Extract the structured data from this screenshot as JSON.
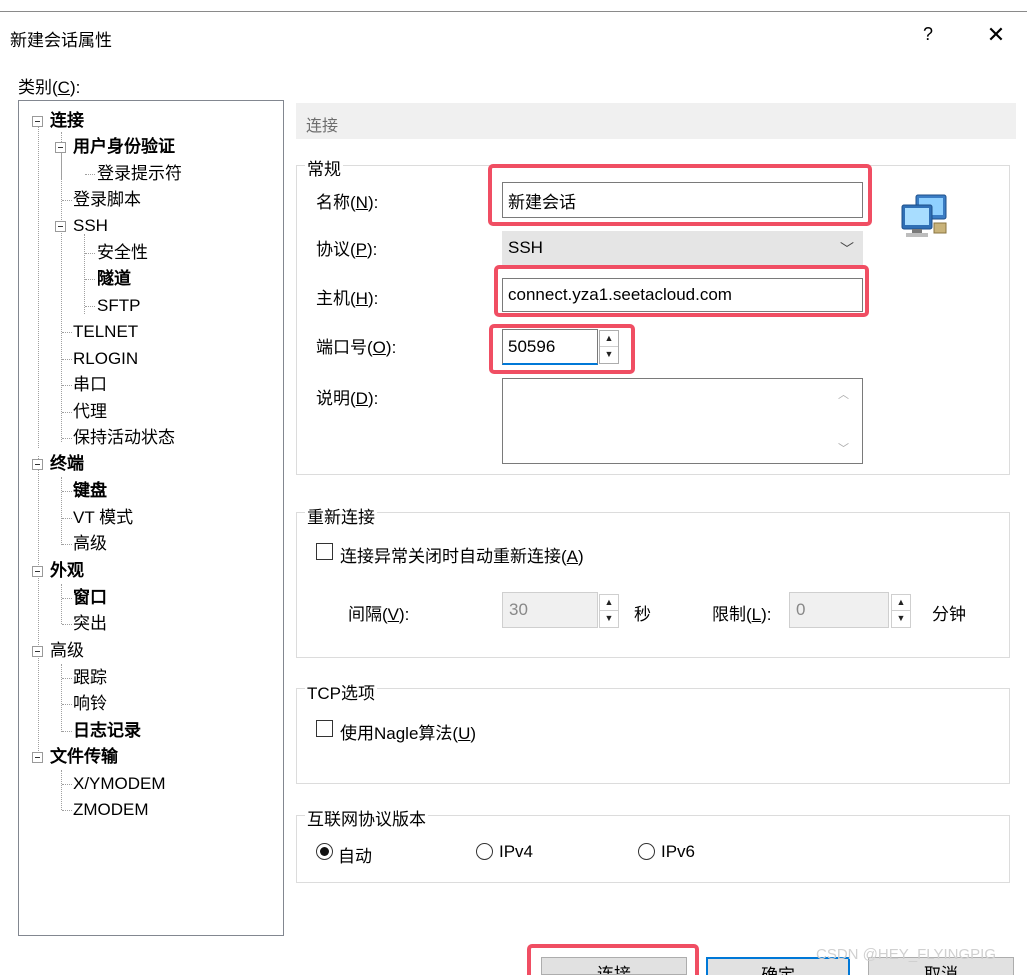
{
  "window": {
    "title": "新建会话属性",
    "help": "?",
    "close": "✕"
  },
  "category_label": {
    "text": "类别(",
    "key": "C",
    "suffix": "):"
  },
  "tree": [
    {
      "label": "连接",
      "bold": true
    },
    {
      "label": "用户身份验证",
      "bold": true
    },
    {
      "label": "登录提示符",
      "bold": false
    },
    {
      "label": "登录脚本",
      "bold": false
    },
    {
      "label": "SSH",
      "bold": false
    },
    {
      "label": "安全性",
      "bold": false
    },
    {
      "label": "隧道",
      "bold": true
    },
    {
      "label": "SFTP",
      "bold": false
    },
    {
      "label": "TELNET",
      "bold": false
    },
    {
      "label": "RLOGIN",
      "bold": false
    },
    {
      "label": "串口",
      "bold": false
    },
    {
      "label": "代理",
      "bold": false
    },
    {
      "label": "保持活动状态",
      "bold": false
    },
    {
      "label": "终端",
      "bold": true
    },
    {
      "label": "键盘",
      "bold": true
    },
    {
      "label": "VT 模式",
      "bold": false
    },
    {
      "label": "高级",
      "bold": false
    },
    {
      "label": "外观",
      "bold": true
    },
    {
      "label": "窗口",
      "bold": true
    },
    {
      "label": "突出",
      "bold": false
    },
    {
      "label": "高级",
      "bold": false
    },
    {
      "label": "跟踪",
      "bold": false
    },
    {
      "label": "响铃",
      "bold": false
    },
    {
      "label": "日志记录",
      "bold": true
    },
    {
      "label": "文件传输",
      "bold": true
    },
    {
      "label": "X/YMODEM",
      "bold": false
    },
    {
      "label": "ZMODEM",
      "bold": false
    }
  ],
  "panel_header": "连接",
  "general": {
    "title": "常规",
    "name_label": {
      "text": "名称(",
      "key": "N",
      "suffix": "):"
    },
    "name_value": "新建会话",
    "protocol_label": {
      "text": "协议(",
      "key": "P",
      "suffix": "):"
    },
    "protocol_value": "SSH",
    "host_label": {
      "text": "主机(",
      "key": "H",
      "suffix": "):"
    },
    "host_value": "connect.yza1.seetacloud.com",
    "port_label": {
      "text": "端口号(",
      "key": "O",
      "suffix": "):"
    },
    "port_value": "50596",
    "desc_label": {
      "text": "说明(",
      "key": "D",
      "suffix": "):"
    },
    "desc_value": ""
  },
  "reconnect": {
    "title": "重新连接",
    "checkbox_label": {
      "text": "连接异常关闭时自动重新连接(",
      "key": "A",
      "suffix": ")"
    },
    "checked": false,
    "interval_label": {
      "text": "间隔(",
      "key": "V",
      "suffix": "):"
    },
    "interval_value": "30",
    "interval_unit": "秒",
    "limit_label": {
      "text": "限制(",
      "key": "L",
      "suffix": "):"
    },
    "limit_value": "0",
    "limit_unit": "分钟"
  },
  "tcp": {
    "title": "TCP选项",
    "nagle_label": {
      "text": "使用Nagle算法(",
      "key": "U",
      "suffix": ")"
    },
    "checked": false
  },
  "ip_version": {
    "title": "互联网协议版本",
    "options": [
      "自动",
      "IPv4",
      "IPv6"
    ],
    "selected": "自动"
  },
  "buttons": {
    "connect": "连接",
    "ok": "确定",
    "cancel": "取消"
  },
  "watermark": "CSDN @HEY_FLYINGPIG"
}
